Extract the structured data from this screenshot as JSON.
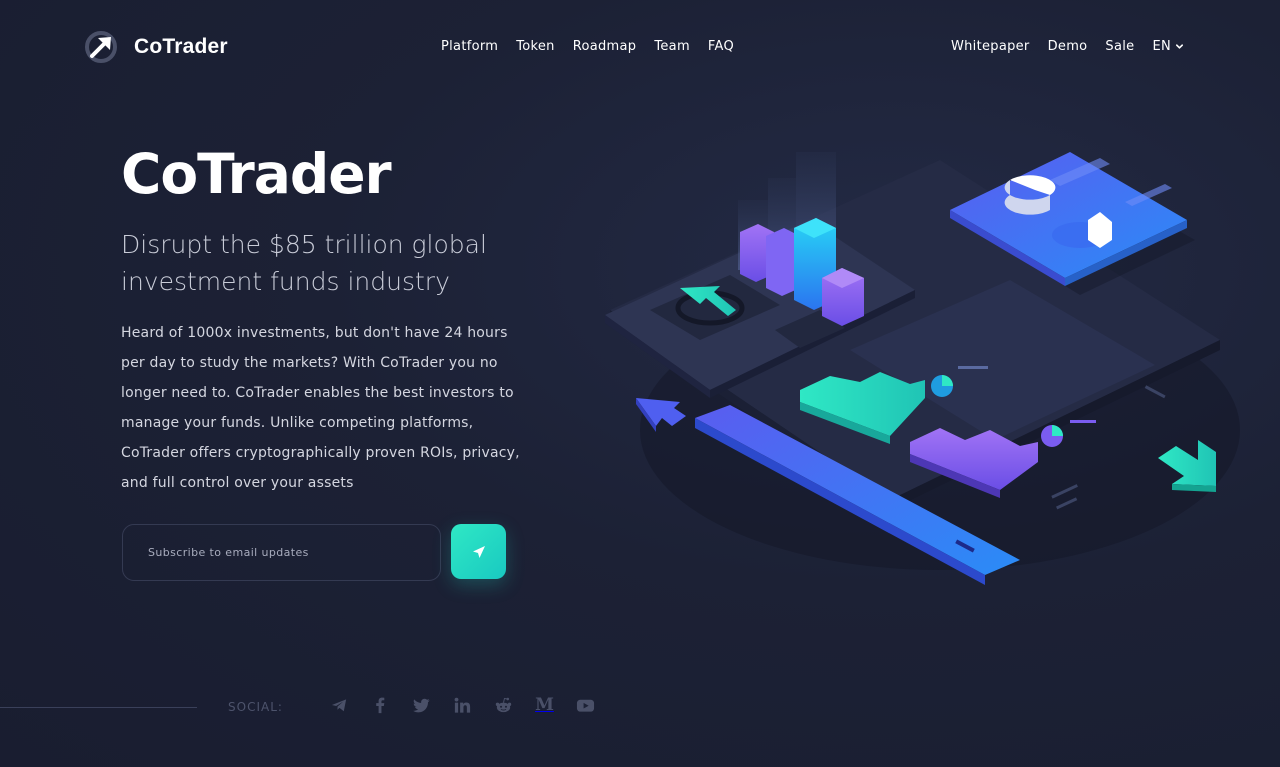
{
  "header": {
    "brand": "CoTrader",
    "nav": [
      "Platform",
      "Token",
      "Roadmap",
      "Team",
      "FAQ"
    ],
    "nav_right": [
      "Whitepaper",
      "Demo",
      "Sale"
    ],
    "language": "EN"
  },
  "hero": {
    "title": "CoTrader",
    "subtitle": "Disrupt the $85 trillion global investment funds industry",
    "description": "Heard of 1000x investments, but don't have 24 hours per day to study the markets? With CoTrader you no longer need to. CoTrader enables the best investors to manage your funds. Unlike competing platforms, CoTrader offers cryptographically proven ROIs, privacy, and full control over your assets"
  },
  "subscribe": {
    "placeholder": "Subscribe to email updates"
  },
  "social": {
    "label": "SOCIAL:",
    "icons": [
      "telegram-icon",
      "facebook-icon",
      "twitter-icon",
      "linkedin-icon",
      "reddit-icon",
      "medium-icon",
      "youtube-icon"
    ],
    "medium_letter": "M"
  },
  "colors": {
    "background": "#1c2135",
    "accent_teal": "#2fe8c5",
    "accent_blue": "#3a6cf0",
    "accent_purple": "#7a5cf0"
  }
}
